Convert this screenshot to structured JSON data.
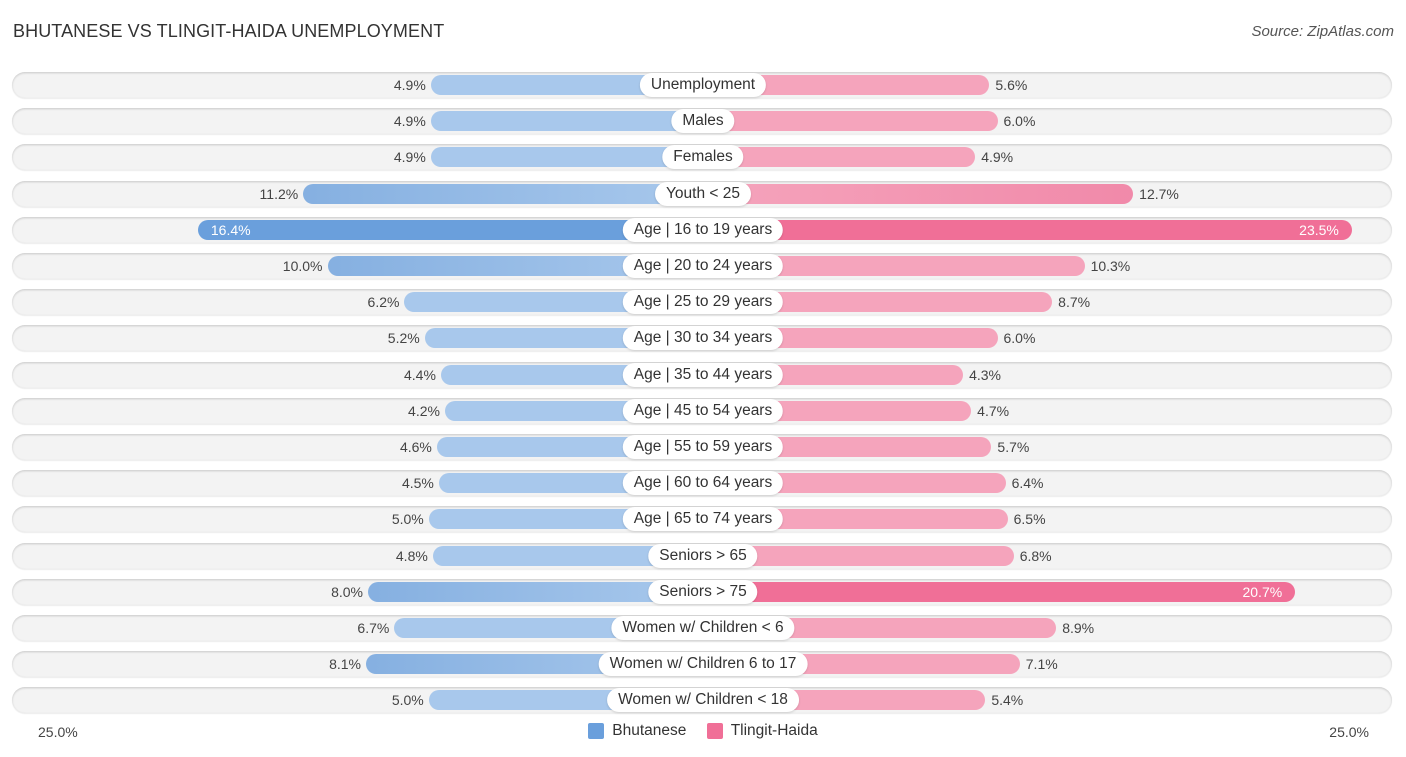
{
  "title": "BHUTANESE VS TLINGIT-HAIDA UNEMPLOYMENT",
  "source": "Source: ZipAtlas.com",
  "colors": {
    "bhutanese": "#6a9fdc",
    "bhutanese_light": "#a8c8ec",
    "tlingit": "#f06f97",
    "tlingit_light": "#f5a4bc"
  },
  "chart_data": {
    "type": "bar",
    "orientation": "horizontal-diverging",
    "title": "BHUTANESE VS TLINGIT-HAIDA UNEMPLOYMENT",
    "categories": [
      "Unemployment",
      "Males",
      "Females",
      "Youth < 25",
      "Age | 16 to 19 years",
      "Age | 20 to 24 years",
      "Age | 25 to 29 years",
      "Age | 30 to 34 years",
      "Age | 35 to 44 years",
      "Age | 45 to 54 years",
      "Age | 55 to 59 years",
      "Age | 60 to 64 years",
      "Age | 65 to 74 years",
      "Seniors > 65",
      "Seniors > 75",
      "Women w/ Children < 6",
      "Women w/ Children 6 to 17",
      "Women w/ Children < 18"
    ],
    "series": [
      {
        "name": "Bhutanese",
        "side": "left",
        "values": [
          4.9,
          4.9,
          4.9,
          11.2,
          16.4,
          10.0,
          6.2,
          5.2,
          4.4,
          4.2,
          4.6,
          4.5,
          5.0,
          4.8,
          8.0,
          6.7,
          8.1,
          5.0
        ],
        "labels": [
          "4.9%",
          "4.9%",
          "4.9%",
          "11.2%",
          "16.4%",
          "10.0%",
          "6.2%",
          "5.2%",
          "4.4%",
          "4.2%",
          "4.6%",
          "4.5%",
          "5.0%",
          "4.8%",
          "8.0%",
          "6.7%",
          "8.1%",
          "5.0%"
        ]
      },
      {
        "name": "Tlingit-Haida",
        "side": "right",
        "values": [
          5.6,
          6.0,
          4.9,
          12.7,
          23.5,
          10.3,
          8.7,
          6.0,
          4.3,
          4.7,
          5.7,
          6.4,
          6.5,
          6.8,
          20.7,
          8.9,
          7.1,
          5.4
        ],
        "labels": [
          "5.6%",
          "6.0%",
          "4.9%",
          "12.7%",
          "23.5%",
          "10.3%",
          "8.7%",
          "6.0%",
          "4.3%",
          "4.7%",
          "5.7%",
          "6.4%",
          "6.5%",
          "6.8%",
          "20.7%",
          "8.9%",
          "7.1%",
          "5.4%"
        ]
      }
    ],
    "xlim": [
      -25,
      25
    ],
    "axis_labels": {
      "left": "25.0%",
      "right": "25.0%"
    },
    "legend": [
      "Bhutanese",
      "Tlingit-Haida"
    ],
    "legend_position": "bottom-center",
    "units": "%"
  }
}
